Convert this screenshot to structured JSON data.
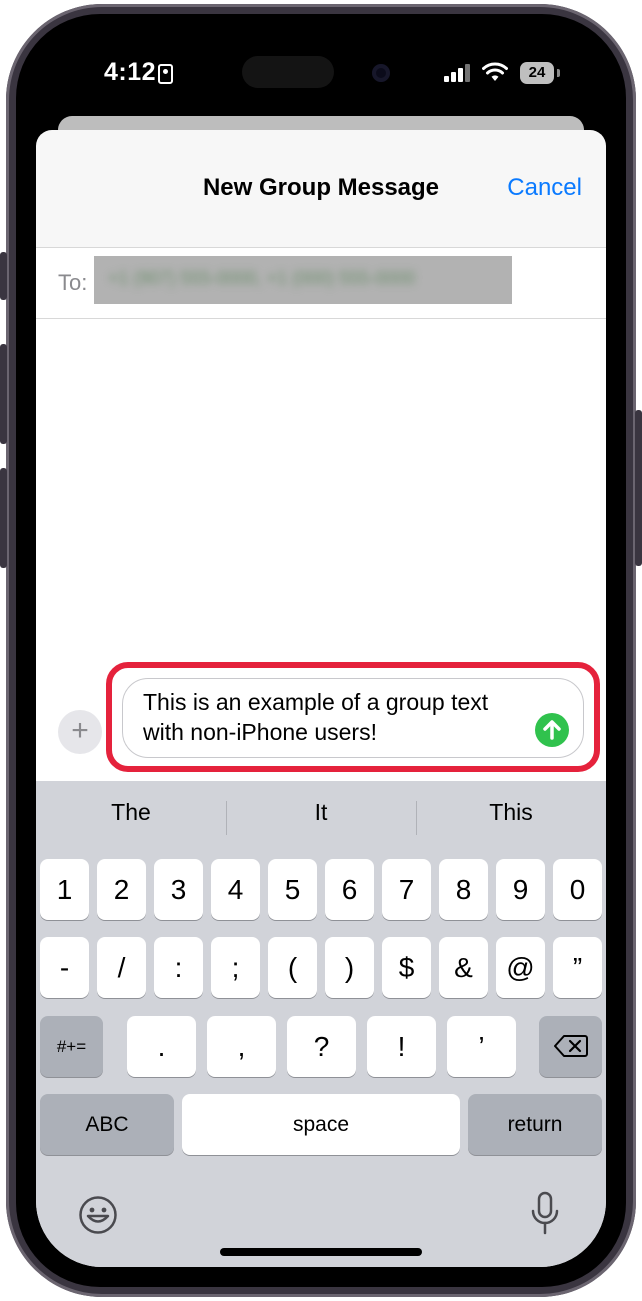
{
  "status_bar": {
    "time": "4:12",
    "battery": "24"
  },
  "header": {
    "title": "New Group Message",
    "cancel_label": "Cancel"
  },
  "recipients": {
    "label": "To:",
    "value": "+1 (907) 555-0000, +1 (000) 555-0000"
  },
  "compose": {
    "plus_label": "+",
    "message_text": "This is an example of a group text with non-iPhone users!"
  },
  "keyboard": {
    "suggestions": [
      "The",
      "It",
      "This"
    ],
    "row1": [
      "1",
      "2",
      "3",
      "4",
      "5",
      "6",
      "7",
      "8",
      "9",
      "0"
    ],
    "row2": [
      "-",
      "/",
      ":",
      ";",
      "(",
      ")",
      "$",
      "&",
      "@",
      "”"
    ],
    "row3_left": "#+=",
    "row3": [
      ".",
      ",",
      "?",
      "!",
      "’"
    ],
    "abc": "ABC",
    "space": "space",
    "return": "return"
  },
  "colors": {
    "accent": "#0a7aff",
    "send": "#30c24d",
    "highlight": "#e5223c"
  },
  "icons": [
    "contact-card-icon",
    "signal-icon",
    "wifi-icon",
    "battery-icon",
    "send-arrow-icon",
    "backspace-icon",
    "emoji-icon",
    "microphone-icon"
  ]
}
